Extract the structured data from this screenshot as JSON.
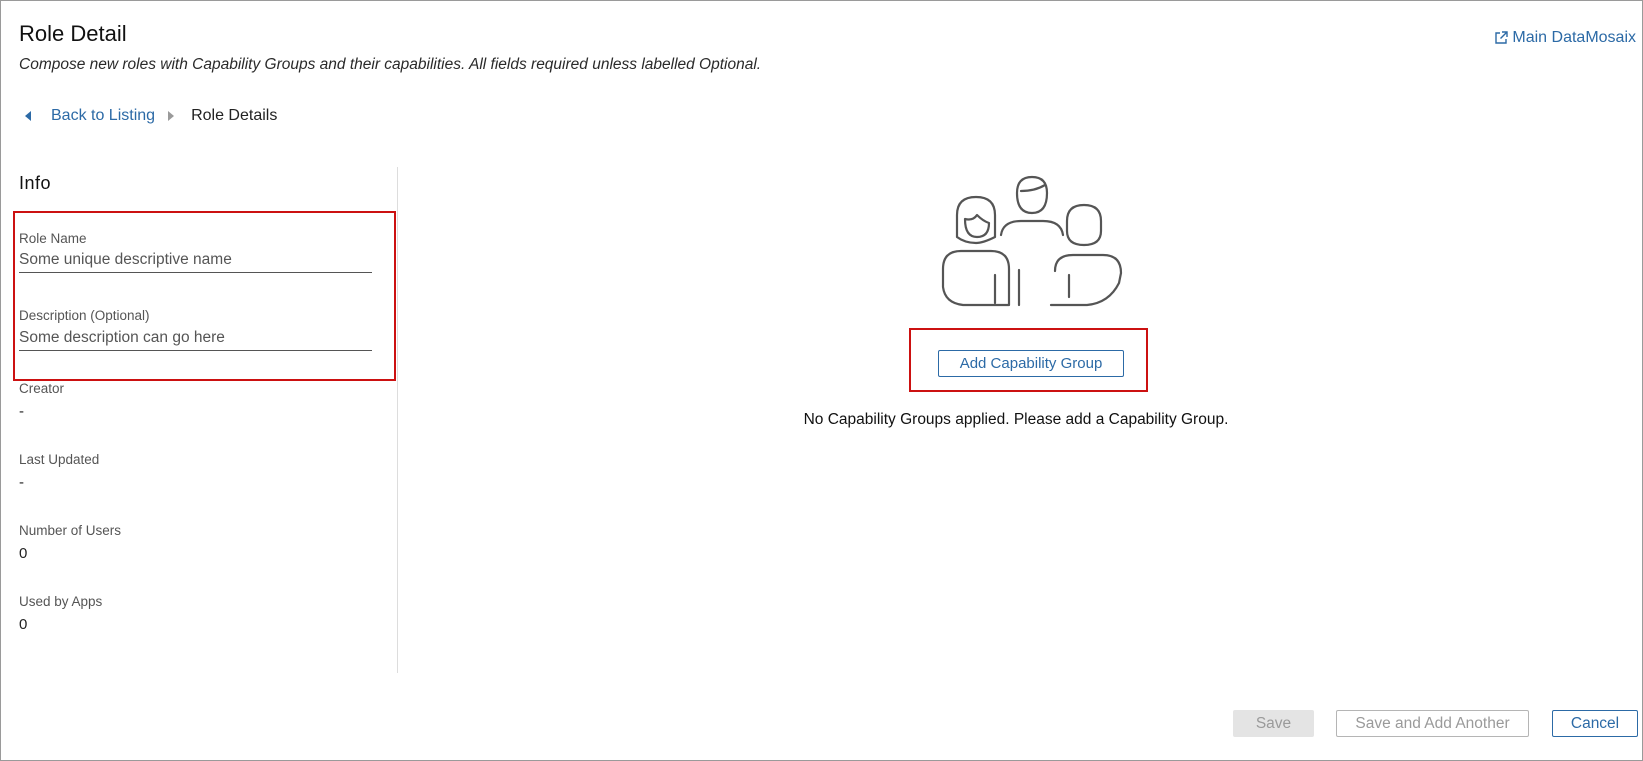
{
  "header": {
    "title": "Role Detail",
    "subtitle": "Compose new roles with Capability Groups and their capabilities. All fields required unless labelled Optional.",
    "external_link": {
      "label": "Main DataMosaix",
      "icon": "external-link-icon"
    }
  },
  "breadcrumb": {
    "back_label": "Back to Listing",
    "current_label": "Role Details"
  },
  "info": {
    "title": "Info",
    "role_name": {
      "label": "Role Name",
      "value": "",
      "placeholder": "Some unique descriptive name"
    },
    "description": {
      "label": "Description (Optional)",
      "value": "",
      "placeholder": "Some description can go here"
    },
    "creator": {
      "label": "Creator",
      "value": "-"
    },
    "last_updated": {
      "label": "Last Updated",
      "value": "-"
    },
    "number_of_users": {
      "label": "Number of Users",
      "value": "0"
    },
    "used_by_apps": {
      "label": "Used by Apps",
      "value": "0"
    }
  },
  "capability_groups": {
    "illustration": "people-group-icon",
    "add_button_label": "Add Capability Group",
    "empty_message": "No Capability Groups applied. Please add a Capability Group."
  },
  "footer": {
    "save_label": "Save",
    "save_another_label": "Save and Add Another",
    "cancel_label": "Cancel"
  },
  "colors": {
    "link": "#2c6aa6",
    "highlight": "#cc1111",
    "disabled_bg": "#e4e4e4",
    "disabled_text": "#9a9a9a"
  }
}
